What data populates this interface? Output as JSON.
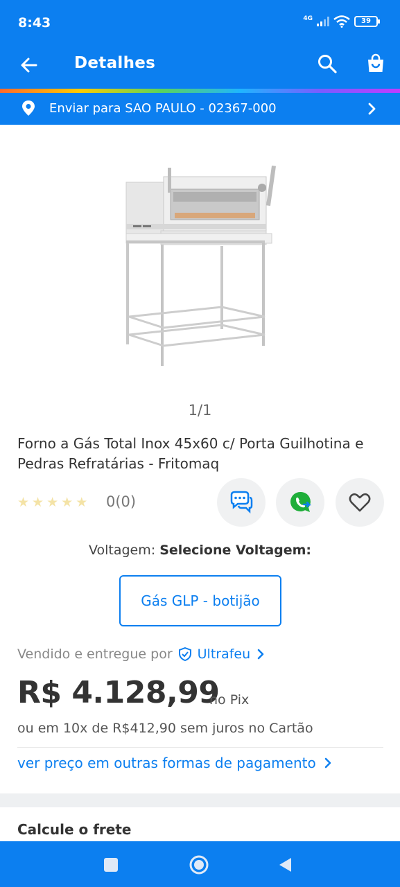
{
  "status": {
    "time": "8:43",
    "network": "4G",
    "battery": "39"
  },
  "appbar": {
    "title": "Detalhes"
  },
  "shipping": {
    "text": "Enviar para SAO PAULO - 02367-000"
  },
  "gallery": {
    "counter": "1/1"
  },
  "product": {
    "title": "Forno a Gás Total Inox 45x60 c/ Porta Guilhotina e Pedras Refratárias - Fritomaq",
    "rating_text": "0(0)",
    "stars": 0
  },
  "voltage": {
    "label": "Voltagem:",
    "value": "Selecione Voltagem:",
    "option": "Gás GLP - botijão"
  },
  "seller": {
    "prefix": "Vendido e entregue por",
    "name": "Ultrafeu"
  },
  "price": {
    "value": "R$ 4.128,99",
    "method": "no Pix",
    "installments": "ou em 10x de R$412,90 sem juros no Cartão",
    "more_link": "ver preço em outras formas de pagamento"
  },
  "next_section": {
    "title_partial": "Calcule o frete"
  },
  "colors": {
    "primary": "#0c7ff0",
    "text": "#333333",
    "muted": "#888888",
    "whatsapp": "#1fae3a"
  }
}
